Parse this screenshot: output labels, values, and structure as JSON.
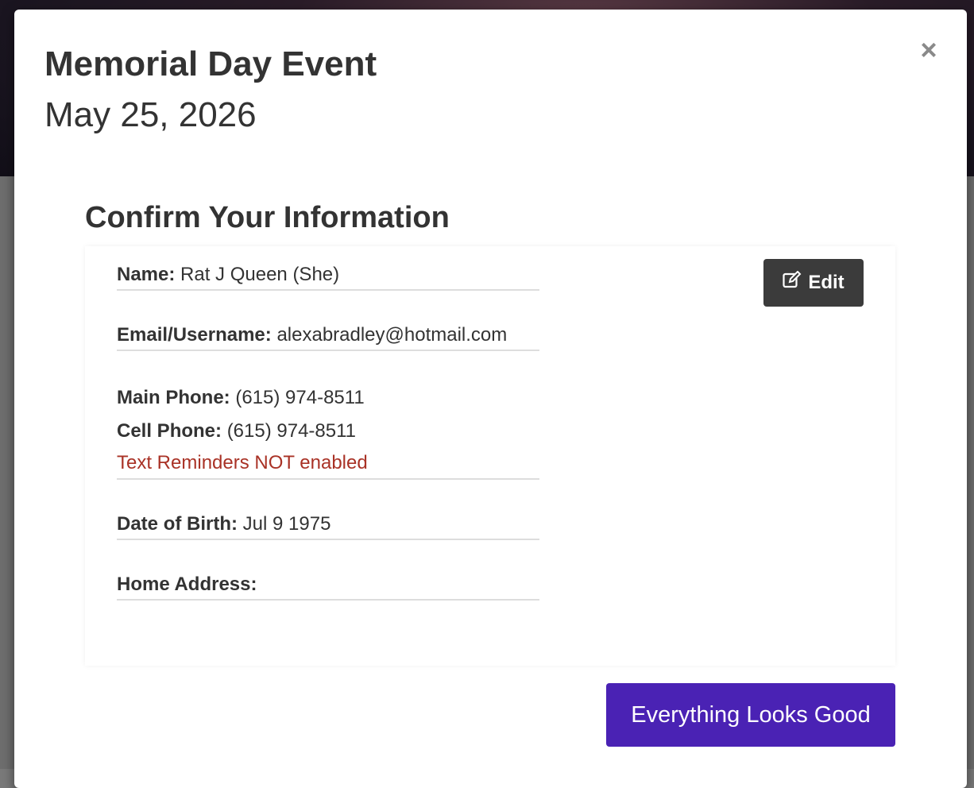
{
  "modal": {
    "title": "Memorial Day Event",
    "date": "May 25, 2026",
    "close_label": "×"
  },
  "confirm": {
    "heading": "Confirm Your Information",
    "edit_label": "Edit",
    "name_label": "Name:",
    "name_value": "Rat J Queen (She)",
    "email_label": "Email/Username:",
    "email_value": "alexabradley@hotmail.com",
    "main_phone_label": "Main Phone:",
    "main_phone_value": "(615) 974-8511",
    "cell_phone_label": "Cell Phone:",
    "cell_phone_value": "(615) 974-8511",
    "text_reminders_status": "Text Reminders NOT enabled",
    "dob_label": "Date of Birth:",
    "dob_value": "Jul 9 1975",
    "address_label": "Home Address:",
    "address_value": "",
    "submit_label": "Everything Looks Good"
  },
  "colors": {
    "primary_button": "#4a22b4",
    "edit_button": "#3b3b3b",
    "warning_text": "#a93226"
  }
}
